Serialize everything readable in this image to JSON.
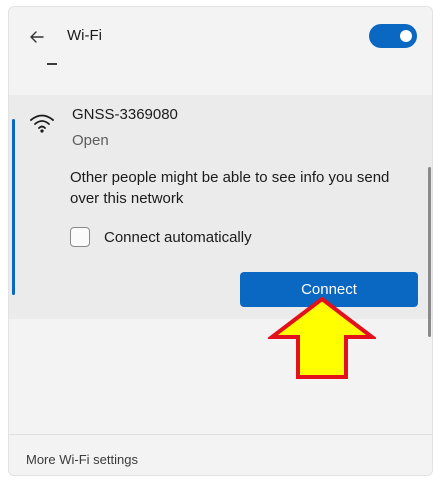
{
  "header": {
    "title": "Wi-Fi",
    "back_icon": "back-arrow-icon",
    "toggle_state": "on"
  },
  "network": {
    "ssid": "GNSS-3369080",
    "security": "Open",
    "warning": "Other people might be able to see info you send over this network",
    "connect_automatically_label": "Connect automatically",
    "connect_automatically_checked": false,
    "connect_label": "Connect",
    "icon": "wifi-signal-icon"
  },
  "footer": {
    "settings_link": "More Wi-Fi settings"
  },
  "annotation": {
    "icon": "yellow-arrow-pointer-icon"
  },
  "colors": {
    "accent": "#0a67c2",
    "arrow_fill": "#ffff00",
    "arrow_stroke": "#e3111b"
  }
}
